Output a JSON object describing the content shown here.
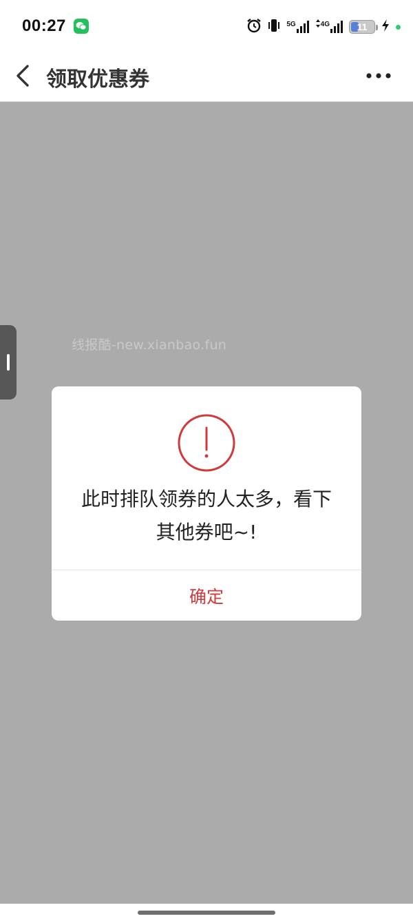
{
  "status_bar": {
    "time": "00:27",
    "network_1": "5G",
    "network_2": "4G",
    "battery_level": "11",
    "battery_fraction": 0.11,
    "colors": {
      "wechat": "#22c15e",
      "battery": "#5a7fd6",
      "dot": "#2ecc71"
    },
    "icons": [
      "wechat-icon",
      "alarm-icon",
      "vibrate-icon",
      "signal-5g-icon",
      "signal-4g-icon",
      "battery-icon",
      "charging-icon",
      "green-dot"
    ]
  },
  "nav": {
    "title": "领取优惠券",
    "back_icon": "chevron-left-icon",
    "more_icon": "more-icon"
  },
  "watermark": "线报酷-new.xianbao.fun",
  "dialog": {
    "icon": "alert-circle-icon",
    "message_line1": "此时排队领券的人太多，看下",
    "message_line2": "其他券吧~!",
    "confirm_label": "确定",
    "accent_color": "#d03a3a"
  }
}
